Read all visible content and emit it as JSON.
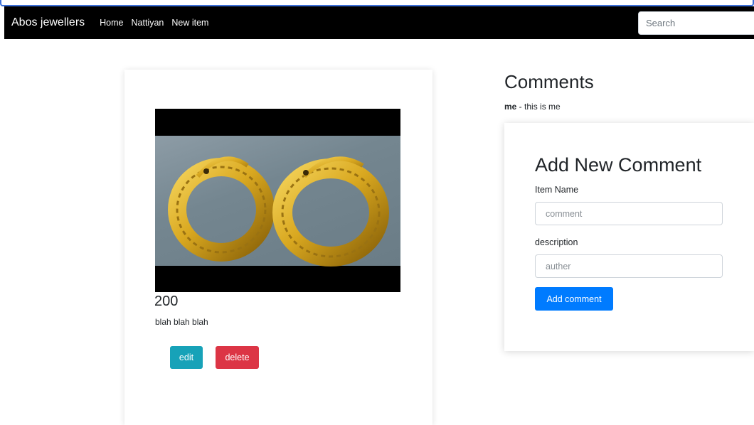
{
  "navbar": {
    "brand": "Abos jewellers",
    "links": [
      "Home",
      "Nattiyan",
      "New item"
    ],
    "search_placeholder": "Search"
  },
  "item": {
    "image_icon": "gold-hoop-earrings-photo",
    "price": "200",
    "description": "blah blah blah",
    "edit_label": "edit",
    "delete_label": "delete"
  },
  "comments": {
    "title": "Comments",
    "list": [
      {
        "author": "me",
        "separator": " - ",
        "text": "this is me"
      }
    ]
  },
  "form": {
    "title": "Add New Comment",
    "field1_label": "Item Name",
    "field1_placeholder": "comment",
    "field2_label": "description",
    "field2_placeholder": "auther",
    "submit_label": "Add comment"
  },
  "colors": {
    "navbar_bg": "#000000",
    "edit_button": "#17a2b8",
    "delete_button": "#dc3545",
    "primary_button": "#007bff"
  }
}
